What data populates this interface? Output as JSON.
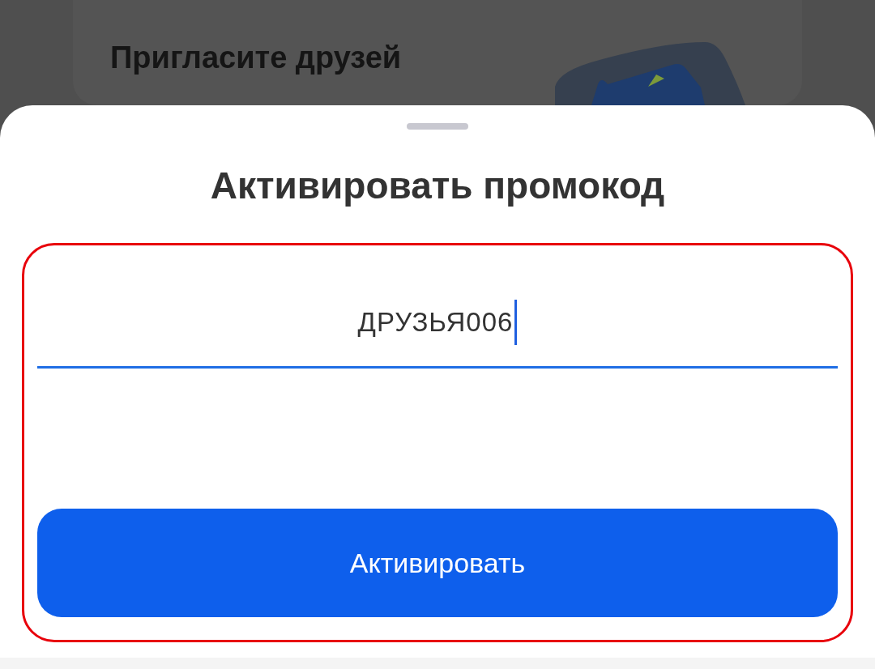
{
  "background_card": {
    "title": "Пригласите друзей"
  },
  "sheet": {
    "title": "Активировать промокод",
    "promo_field": {
      "value": "ДРУЗЬЯ006",
      "focused": true
    },
    "highlighted": true,
    "button": {
      "label": "Активировать"
    }
  }
}
